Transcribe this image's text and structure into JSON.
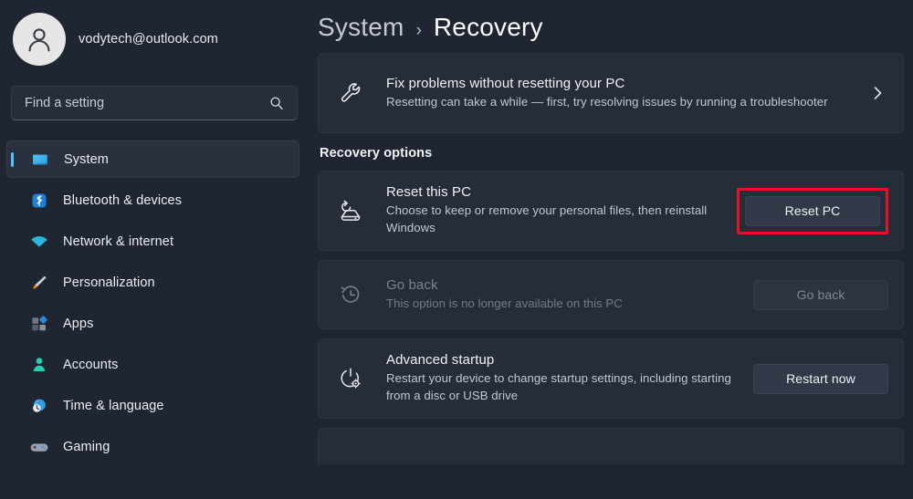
{
  "account": {
    "email": "vodytech@outlook.com",
    "avatar_icon": "person-avatar-icon"
  },
  "search": {
    "placeholder": "Find a setting",
    "value": "",
    "icon": "search-icon"
  },
  "sidebar": {
    "items": [
      {
        "label": "System",
        "icon": "monitor-icon",
        "selected": true
      },
      {
        "label": "Bluetooth & devices",
        "icon": "bluetooth-icon",
        "selected": false
      },
      {
        "label": "Network & internet",
        "icon": "wifi-icon",
        "selected": false
      },
      {
        "label": "Personalization",
        "icon": "paintbrush-icon",
        "selected": false
      },
      {
        "label": "Apps",
        "icon": "apps-icon",
        "selected": false
      },
      {
        "label": "Accounts",
        "icon": "account-icon",
        "selected": false
      },
      {
        "label": "Time & language",
        "icon": "clock-globe-icon",
        "selected": false
      },
      {
        "label": "Gaming",
        "icon": "gamepad-icon",
        "selected": false
      }
    ]
  },
  "breadcrumb": {
    "parent": "System",
    "separator": "›",
    "current": "Recovery"
  },
  "main": {
    "fix_problems": {
      "title": "Fix problems without resetting your PC",
      "desc": "Resetting can take a while — first, try resolving issues by running a troubleshooter",
      "icon": "wrench-icon",
      "chevron": "chevron-right-icon"
    },
    "section_title": "Recovery options",
    "options": [
      {
        "title": "Reset this PC",
        "desc": "Choose to keep or remove your personal files, then reinstall Windows",
        "icon": "reset-pc-icon",
        "button": "Reset PC",
        "disabled": false,
        "highlighted": true
      },
      {
        "title": "Go back",
        "desc": "This option is no longer available on this PC",
        "icon": "history-clock-icon",
        "button": "Go back",
        "disabled": true,
        "highlighted": false
      },
      {
        "title": "Advanced startup",
        "desc": "Restart your device to change startup settings, including starting from a disc or USB drive",
        "icon": "power-gear-icon",
        "button": "Restart now",
        "disabled": false,
        "highlighted": false
      }
    ]
  },
  "colors": {
    "accent": "#4cc2ff",
    "highlight_red": "#e81123",
    "page_background": "#202532",
    "card_background": "#272c39"
  }
}
